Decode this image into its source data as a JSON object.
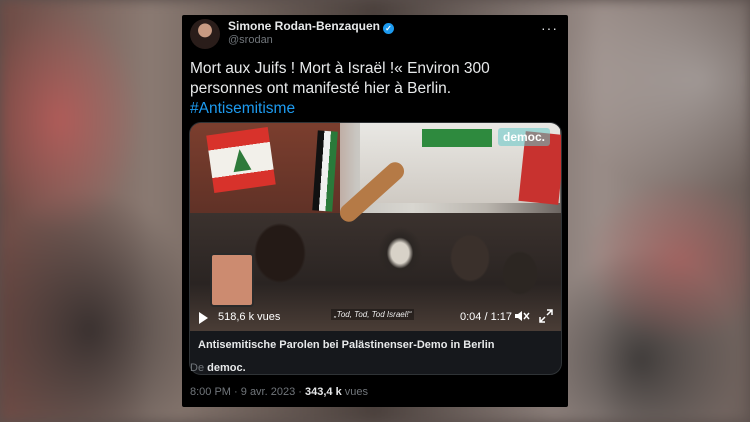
{
  "tweet": {
    "author_name": "Simone Rodan-Benzaquen",
    "author_handle": "@srodan",
    "verified_mark": "✓",
    "more_label": "···",
    "text": "Mort aux Juifs ! Mort à Israël !« Environ 300 personnes ont manifesté hier à Berlin.",
    "hashtag": "#Antisemitisme",
    "source_prefix": "De",
    "source_name": "democ.",
    "time": "8:00 PM",
    "separator": "·",
    "date": "9 avr. 2023",
    "views_count": "343,4 k",
    "views_label": "vues"
  },
  "media": {
    "watermark": "democ.",
    "view_count": "518,6 k vues",
    "caption": "„Tod, Tod, Tod Israel!“",
    "time_display": "0:04 / 1:17",
    "title": "Antisemitische Parolen bei Palästinenser-Demo in Berlin"
  },
  "colors": {
    "background": "#000000",
    "text": "#e7e9ea",
    "secondary_text": "#71767b",
    "link": "#1d9bf0",
    "verified": "#1d9bf0"
  },
  "icons": [
    "verified-icon",
    "more-icon",
    "play-icon",
    "mute-icon",
    "expand-icon"
  ]
}
